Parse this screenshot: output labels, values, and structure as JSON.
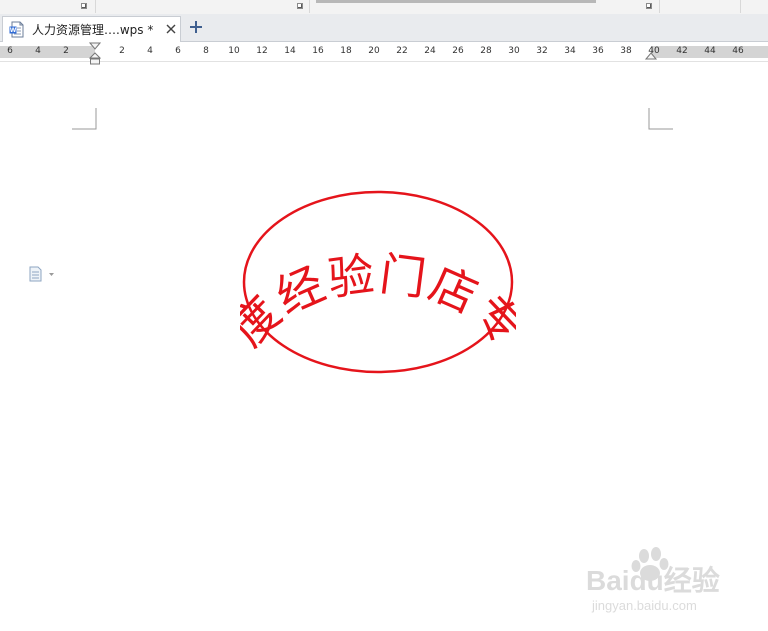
{
  "document_tab": {
    "title": "人力资源管理….wps *",
    "file_icon": "wps-document-icon",
    "close_icon": "close-icon"
  },
  "new_tab_icon": "plus-icon",
  "ruler": {
    "labels": [
      "6",
      "4",
      "2",
      "2",
      "4",
      "6",
      "8",
      "10",
      "12",
      "14",
      "16",
      "18",
      "20",
      "22",
      "24",
      "26",
      "28",
      "30",
      "32",
      "34",
      "36",
      "38",
      "40",
      "42",
      "44",
      "46"
    ]
  },
  "paragraph_menu_icon": "document-paragraph-icon",
  "seal": {
    "text": "百度经验门店专用",
    "color": "#e5141b"
  },
  "watermark": {
    "text": "Baidu经验",
    "url_text": "jingyan.baidu.com"
  }
}
